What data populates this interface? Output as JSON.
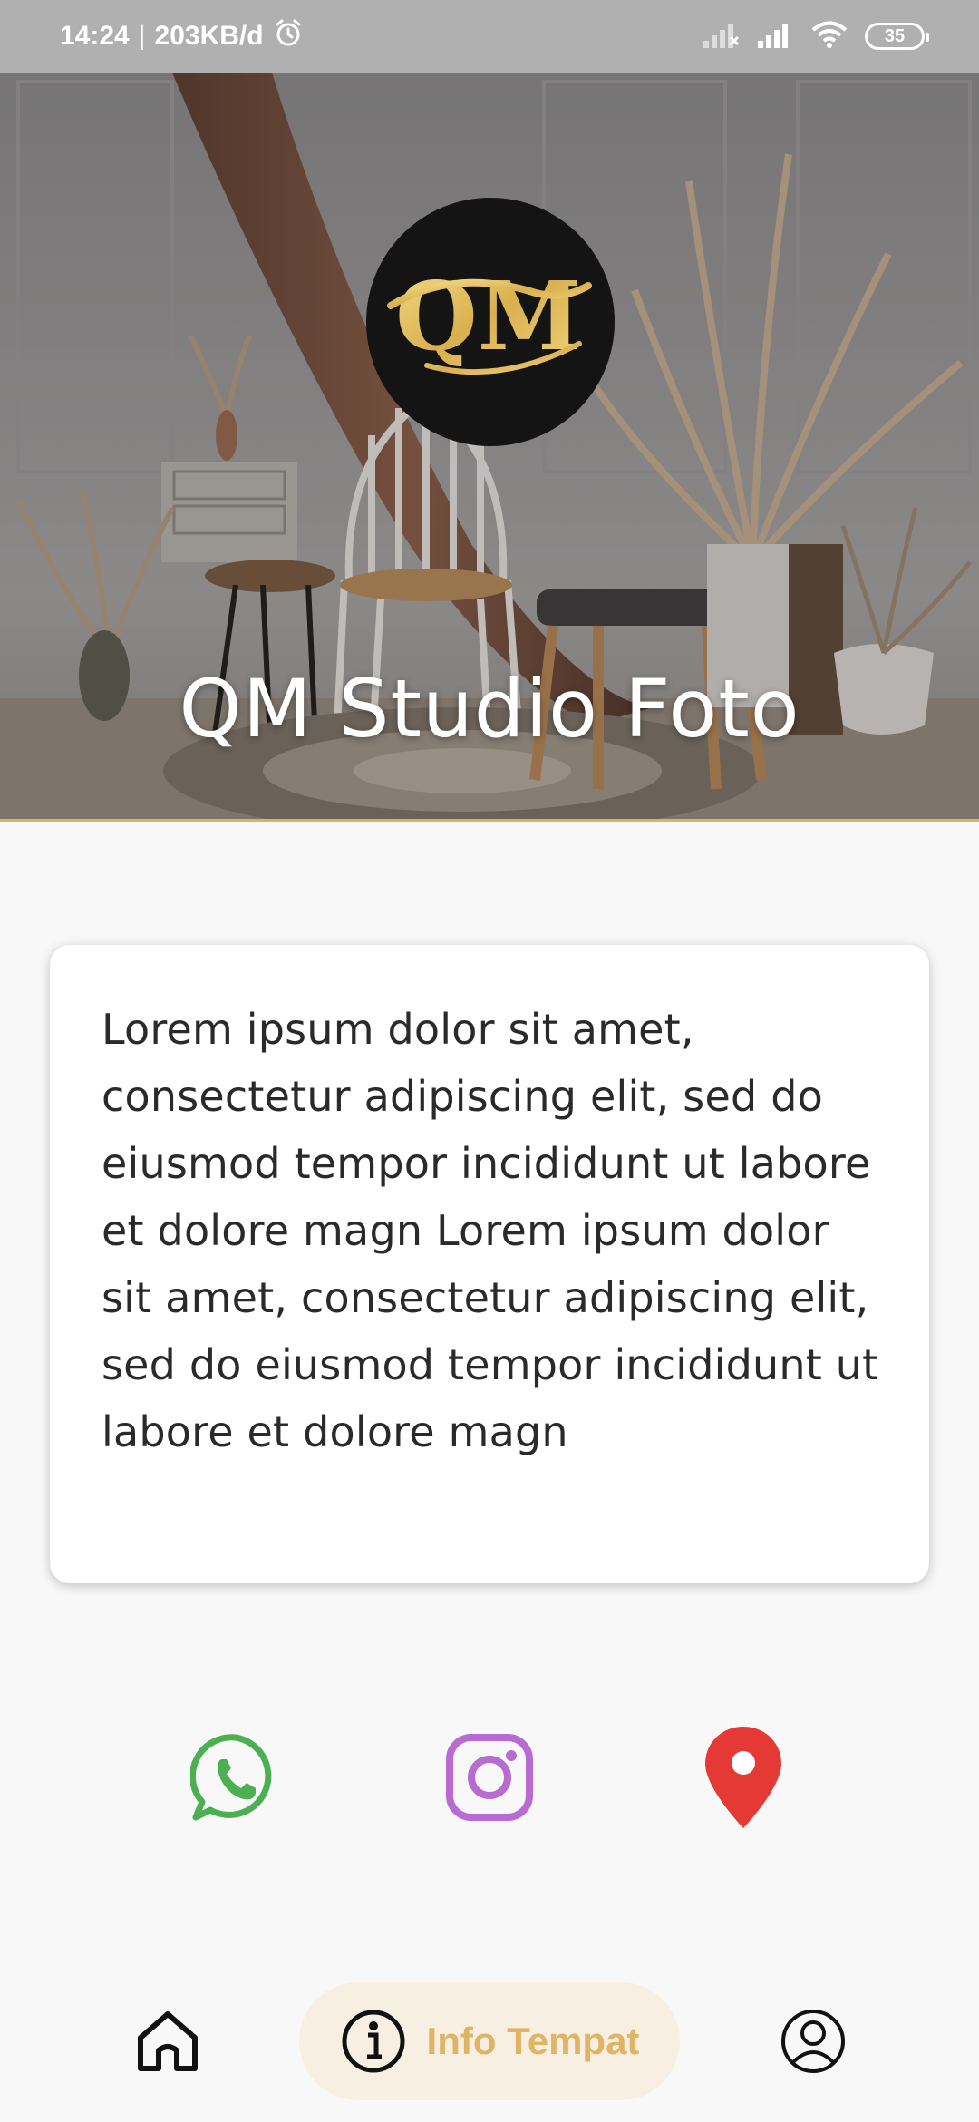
{
  "status_bar": {
    "time": "14:24",
    "separator": "|",
    "data_rate": "203KB/d",
    "battery_level": "35"
  },
  "hero": {
    "title": "QM Studio Foto",
    "logo_text": "QM"
  },
  "card": {
    "description": "Lorem ipsum dolor sit amet, consectetur adipiscing elit, sed do eiusmod tempor incididunt ut labore et dolore magn Lorem ipsum dolor sit amet, consectetur adipiscing elit, sed do eiusmod tempor incididunt ut labore et dolore magn"
  },
  "social": [
    {
      "icon": "whatsapp-icon",
      "color": "#4caf50"
    },
    {
      "icon": "instagram-icon",
      "color": "#b86bd1"
    },
    {
      "icon": "location-pin-icon",
      "color": "#e53935"
    }
  ],
  "bottom_nav": {
    "home_icon": "home-icon",
    "info_label": "Info Tempat",
    "info_icon": "info-icon",
    "profile_icon": "profile-icon",
    "active_color": "#e0b465",
    "active_bg": "#f7efe1"
  }
}
